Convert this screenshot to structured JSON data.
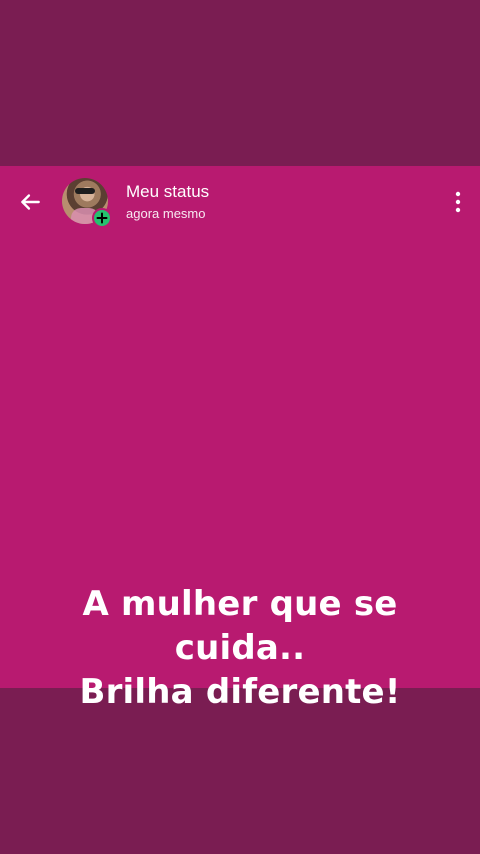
{
  "status_header": {
    "title": "Meu status",
    "time": "agora mesmo"
  },
  "status_content": {
    "line1": "A mulher que se cuida..",
    "line2": "Brilha diferente!"
  },
  "colors": {
    "outer_background": "#7a1d52",
    "status_background": "#b81a70",
    "badge_green": "#25c16f",
    "text": "#ffffff"
  },
  "icons": {
    "back": "back-arrow-icon",
    "add": "plus-icon",
    "menu": "vertical-dots-icon"
  }
}
